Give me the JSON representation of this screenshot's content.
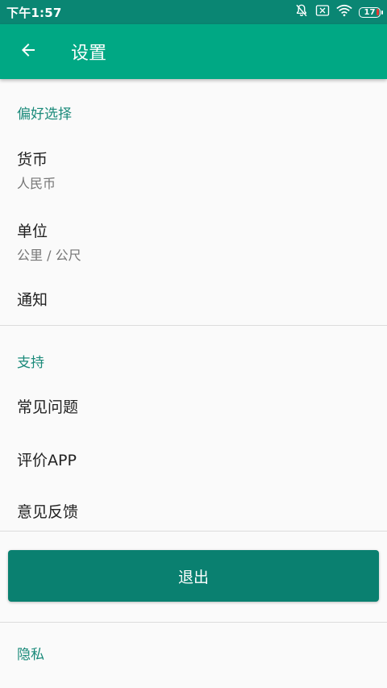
{
  "status_bar": {
    "time": "下午1:57",
    "battery_level": "17",
    "icons": [
      "notifications-off-icon",
      "sim-error-icon",
      "wifi-icon",
      "battery-icon"
    ]
  },
  "app_bar": {
    "title": "设置",
    "back_icon": "arrow-back-icon"
  },
  "preferences": {
    "header": "偏好选择",
    "items": [
      {
        "label": "货币",
        "value": "人民币"
      },
      {
        "label": "单位",
        "value": "公里 / 公尺"
      },
      {
        "label": "通知"
      }
    ]
  },
  "support": {
    "header": "支持",
    "items": [
      {
        "label": "常见问题"
      },
      {
        "label": "评价APP"
      },
      {
        "label": "意见反馈"
      }
    ]
  },
  "logout": {
    "label": "退出"
  },
  "privacy": {
    "header": "隐私"
  },
  "colors": {
    "status_bar": "#0a8673",
    "app_bar": "#00a884",
    "section_header": "#1a8a7a",
    "logout_button": "#0a8070"
  }
}
